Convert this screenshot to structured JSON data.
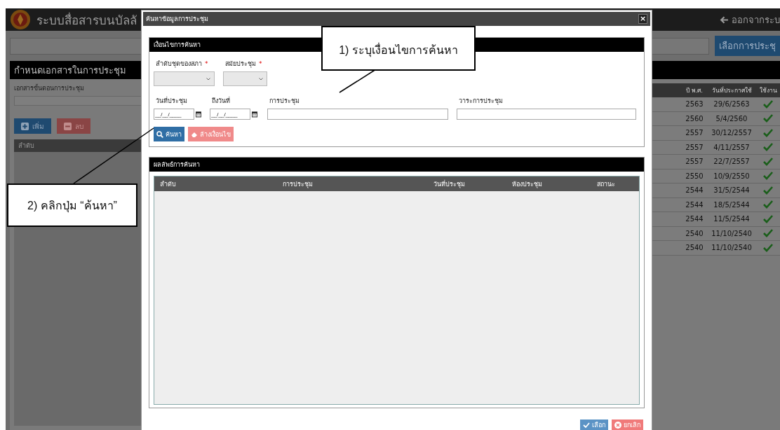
{
  "app": {
    "title": "ระบบสื่อสารบนบัลลั",
    "logout": "ออกจากระบ",
    "select_meeting_button": "เลือกการประชุ"
  },
  "document_panel": {
    "title": "กำหนดเอกสารในการประชุม",
    "field_label": "เอกสารขั้นตอนการประชุม",
    "buttons": [
      {
        "label": "เพิ่ม",
        "kind": "add"
      },
      {
        "label": "ลบ",
        "kind": "remove"
      }
    ],
    "table_column": "ลำดับ"
  },
  "background_table": {
    "columns": [
      "ปี พ.ศ.",
      "วันที่ประกาศใช้",
      "ใช้งาน"
    ],
    "rows": [
      {
        "year": "2563",
        "date": "29/6/2563",
        "active": true
      },
      {
        "year": "2560",
        "date": "5/4/2560",
        "active": true
      },
      {
        "year": "2557",
        "date": "30/12/2557",
        "active": true
      },
      {
        "year": "2557",
        "date": "4/11/2557",
        "active": true
      },
      {
        "year": "2557",
        "date": "22/7/2557",
        "active": true
      },
      {
        "year": "2550",
        "date": "10/9/2550",
        "active": true
      },
      {
        "year": "2544",
        "date": "31/5/2544",
        "active": true
      },
      {
        "year": "2544",
        "date": "18/5/2544",
        "active": true
      },
      {
        "year": "2544",
        "date": "11/5/2544",
        "active": true
      },
      {
        "year": "2540",
        "date": "11/10/2540",
        "active": true
      },
      {
        "year": "2540",
        "date": "11/10/2540",
        "active": true
      }
    ]
  },
  "dialog": {
    "title": "ค้นหาข้อมูลการประชุม",
    "close": "×",
    "criteria": {
      "title": "เงื่อนไขการค้นหา",
      "selects": [
        {
          "label": "ลำดับชุดของสภา",
          "required_mark": "*"
        },
        {
          "label": "สมัยประชุม",
          "required_mark": "*"
        }
      ],
      "fields": [
        {
          "label": "วันที่ประชุม",
          "kind": "date",
          "placeholder": "__/__/____"
        },
        {
          "label": "ถึงวันที่",
          "kind": "date",
          "placeholder": "__/__/____"
        },
        {
          "label": "การประชุม",
          "kind": "text"
        },
        {
          "label": "วาระการประชุม",
          "kind": "text"
        }
      ],
      "buttons": [
        {
          "label": "ค้นหา",
          "kind": "search"
        },
        {
          "label": "ล้างเงื่อนไข",
          "kind": "clear"
        }
      ]
    },
    "results": {
      "title": "ผลลัพธ์การค้นหา",
      "columns": [
        "ลำดับ",
        "การประชุม",
        "วันที่ประชุม",
        "ห้องประชุม",
        "สถานะ"
      ]
    },
    "buttons": [
      {
        "label": "เลือก",
        "kind": "ok"
      },
      {
        "label": "ยกเลิก",
        "kind": "cancel"
      }
    ]
  },
  "callouts": [
    {
      "text": "1) ระบุเงื่อนไขการค้นหา"
    },
    {
      "text": "2) คลิกปุ่ม “ค้นหา”"
    }
  ]
}
